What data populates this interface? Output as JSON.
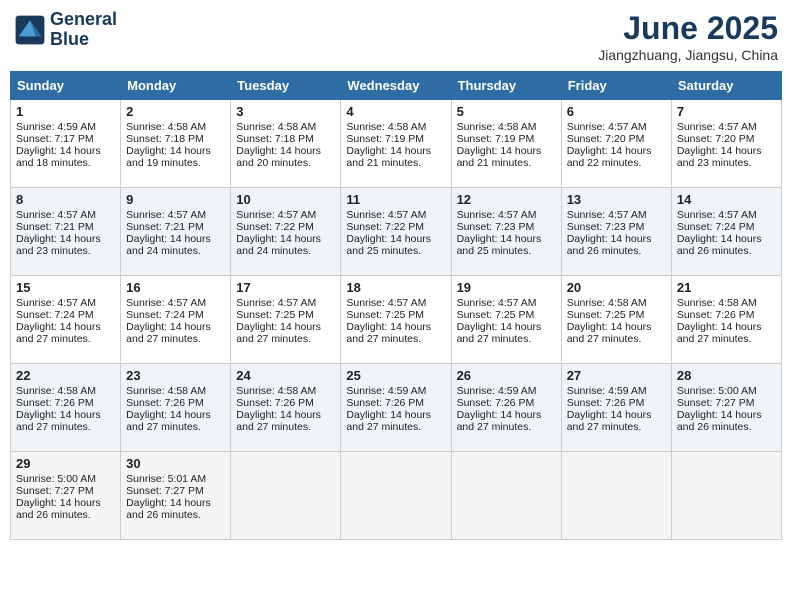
{
  "header": {
    "logo_line1": "General",
    "logo_line2": "Blue",
    "month_year": "June 2025",
    "location": "Jiangzhuang, Jiangsu, China"
  },
  "days_of_week": [
    "Sunday",
    "Monday",
    "Tuesday",
    "Wednesday",
    "Thursday",
    "Friday",
    "Saturday"
  ],
  "weeks": [
    [
      {
        "day": 1,
        "info": "Sunrise: 4:59 AM\nSunset: 7:17 PM\nDaylight: 14 hours\nand 18 minutes."
      },
      {
        "day": 2,
        "info": "Sunrise: 4:58 AM\nSunset: 7:18 PM\nDaylight: 14 hours\nand 19 minutes."
      },
      {
        "day": 3,
        "info": "Sunrise: 4:58 AM\nSunset: 7:18 PM\nDaylight: 14 hours\nand 20 minutes."
      },
      {
        "day": 4,
        "info": "Sunrise: 4:58 AM\nSunset: 7:19 PM\nDaylight: 14 hours\nand 21 minutes."
      },
      {
        "day": 5,
        "info": "Sunrise: 4:58 AM\nSunset: 7:19 PM\nDaylight: 14 hours\nand 21 minutes."
      },
      {
        "day": 6,
        "info": "Sunrise: 4:57 AM\nSunset: 7:20 PM\nDaylight: 14 hours\nand 22 minutes."
      },
      {
        "day": 7,
        "info": "Sunrise: 4:57 AM\nSunset: 7:20 PM\nDaylight: 14 hours\nand 23 minutes."
      }
    ],
    [
      {
        "day": 8,
        "info": "Sunrise: 4:57 AM\nSunset: 7:21 PM\nDaylight: 14 hours\nand 23 minutes."
      },
      {
        "day": 9,
        "info": "Sunrise: 4:57 AM\nSunset: 7:21 PM\nDaylight: 14 hours\nand 24 minutes."
      },
      {
        "day": 10,
        "info": "Sunrise: 4:57 AM\nSunset: 7:22 PM\nDaylight: 14 hours\nand 24 minutes."
      },
      {
        "day": 11,
        "info": "Sunrise: 4:57 AM\nSunset: 7:22 PM\nDaylight: 14 hours\nand 25 minutes."
      },
      {
        "day": 12,
        "info": "Sunrise: 4:57 AM\nSunset: 7:23 PM\nDaylight: 14 hours\nand 25 minutes."
      },
      {
        "day": 13,
        "info": "Sunrise: 4:57 AM\nSunset: 7:23 PM\nDaylight: 14 hours\nand 26 minutes."
      },
      {
        "day": 14,
        "info": "Sunrise: 4:57 AM\nSunset: 7:24 PM\nDaylight: 14 hours\nand 26 minutes."
      }
    ],
    [
      {
        "day": 15,
        "info": "Sunrise: 4:57 AM\nSunset: 7:24 PM\nDaylight: 14 hours\nand 27 minutes."
      },
      {
        "day": 16,
        "info": "Sunrise: 4:57 AM\nSunset: 7:24 PM\nDaylight: 14 hours\nand 27 minutes."
      },
      {
        "day": 17,
        "info": "Sunrise: 4:57 AM\nSunset: 7:25 PM\nDaylight: 14 hours\nand 27 minutes."
      },
      {
        "day": 18,
        "info": "Sunrise: 4:57 AM\nSunset: 7:25 PM\nDaylight: 14 hours\nand 27 minutes."
      },
      {
        "day": 19,
        "info": "Sunrise: 4:57 AM\nSunset: 7:25 PM\nDaylight: 14 hours\nand 27 minutes."
      },
      {
        "day": 20,
        "info": "Sunrise: 4:58 AM\nSunset: 7:25 PM\nDaylight: 14 hours\nand 27 minutes."
      },
      {
        "day": 21,
        "info": "Sunrise: 4:58 AM\nSunset: 7:26 PM\nDaylight: 14 hours\nand 27 minutes."
      }
    ],
    [
      {
        "day": 22,
        "info": "Sunrise: 4:58 AM\nSunset: 7:26 PM\nDaylight: 14 hours\nand 27 minutes."
      },
      {
        "day": 23,
        "info": "Sunrise: 4:58 AM\nSunset: 7:26 PM\nDaylight: 14 hours\nand 27 minutes."
      },
      {
        "day": 24,
        "info": "Sunrise: 4:58 AM\nSunset: 7:26 PM\nDaylight: 14 hours\nand 27 minutes."
      },
      {
        "day": 25,
        "info": "Sunrise: 4:59 AM\nSunset: 7:26 PM\nDaylight: 14 hours\nand 27 minutes."
      },
      {
        "day": 26,
        "info": "Sunrise: 4:59 AM\nSunset: 7:26 PM\nDaylight: 14 hours\nand 27 minutes."
      },
      {
        "day": 27,
        "info": "Sunrise: 4:59 AM\nSunset: 7:26 PM\nDaylight: 14 hours\nand 27 minutes."
      },
      {
        "day": 28,
        "info": "Sunrise: 5:00 AM\nSunset: 7:27 PM\nDaylight: 14 hours\nand 26 minutes."
      }
    ],
    [
      {
        "day": 29,
        "info": "Sunrise: 5:00 AM\nSunset: 7:27 PM\nDaylight: 14 hours\nand 26 minutes."
      },
      {
        "day": 30,
        "info": "Sunrise: 5:01 AM\nSunset: 7:27 PM\nDaylight: 14 hours\nand 26 minutes."
      },
      {
        "day": null,
        "info": ""
      },
      {
        "day": null,
        "info": ""
      },
      {
        "day": null,
        "info": ""
      },
      {
        "day": null,
        "info": ""
      },
      {
        "day": null,
        "info": ""
      }
    ]
  ]
}
